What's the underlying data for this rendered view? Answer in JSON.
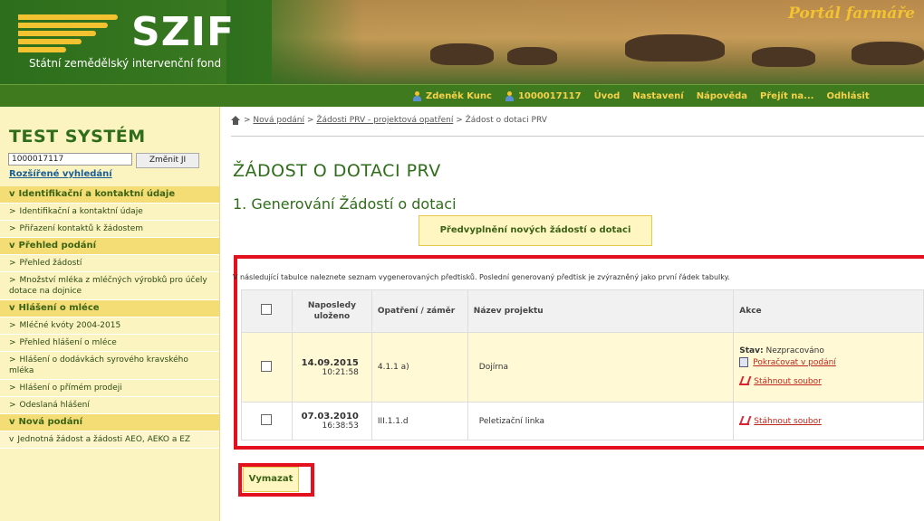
{
  "header": {
    "logo_text": "SZIF",
    "logo_subtitle": "Státní zemědělský intervenční fond",
    "portal_title": "Portál farmáře"
  },
  "topnav": {
    "user_name": "Zdeněk Kunc",
    "user_id": "1000017117",
    "items": [
      "Úvod",
      "Nastavení",
      "Nápověda",
      "Přejít na...",
      "Odhlásit"
    ]
  },
  "sidebar": {
    "system_title": "TEST SYSTÉM",
    "search_value": "1000017117",
    "change_button": "Změnit JI",
    "advanced_search": "Rozšířené vyhledání",
    "items": [
      {
        "label": "Identifikační a kontaktní údaje",
        "type": "section",
        "marker": "v"
      },
      {
        "label": "Identifikační a kontaktní údaje",
        "type": "item",
        "marker": ">"
      },
      {
        "label": "Přiřazení kontaktů k žádostem",
        "type": "item",
        "marker": ">"
      },
      {
        "label": "Přehled podání",
        "type": "section",
        "marker": "v"
      },
      {
        "label": "Přehled žádostí",
        "type": "item",
        "marker": ">"
      },
      {
        "label": "Množství mléka z mléčných výrobků pro účely dotace na dojnice",
        "type": "item",
        "marker": ">"
      },
      {
        "label": "Hlášení o mléce",
        "type": "section",
        "marker": "v"
      },
      {
        "label": "Mléčné kvóty 2004-2015",
        "type": "item",
        "marker": ">"
      },
      {
        "label": "Přehled hlášení o mléce",
        "type": "item",
        "marker": ">"
      },
      {
        "label": "Hlášení o dodávkách syrového kravského mléka",
        "type": "item",
        "marker": ">"
      },
      {
        "label": "Hlášení o přímém prodeji",
        "type": "item",
        "marker": ">"
      },
      {
        "label": "Odeslaná hlášení",
        "type": "item",
        "marker": ">"
      },
      {
        "label": "Nová podání",
        "type": "section",
        "marker": "v"
      },
      {
        "label": "Jednotná žádost a žádosti AEO, AEKO a EZ",
        "type": "sub",
        "marker": "v"
      }
    ]
  },
  "breadcrumb": {
    "sep": ">",
    "links": [
      "Nová podání",
      "Žádosti PRV - projektová opatření"
    ],
    "current": "Žádost o dotaci PRV"
  },
  "main": {
    "page_title": "ŽÁDOST O DOTACI PRV",
    "section_title": "1. Generování Žádostí o dotaci",
    "prefill_button": "Předvyplnění nových žádostí o dotaci",
    "table_note": "V následující tabulce naleznete seznam vygenerovaných předtisků. Poslední generovaný předtisk je zvýrazněný jako první řádek tabulky.",
    "table": {
      "headers": [
        "Naposledy uloženo",
        "Opatření / záměr",
        "Název projektu",
        "Akce"
      ],
      "rows": [
        {
          "date": "14.09.2015",
          "time": "10:21:58",
          "measure": "4.1.1 a)",
          "project": "Dojírna",
          "status_label": "Stav:",
          "status_value": "Nezpracováno",
          "continue_link": "Pokračovat v podání",
          "download_link": "Stáhnout soubor"
        },
        {
          "date": "07.03.2010",
          "time": "16:38:53",
          "measure": "III.1.1.d",
          "project": "Peletizační linka",
          "download_link": "Stáhnout soubor"
        }
      ]
    },
    "delete_button": "Vymazat"
  },
  "colors": {
    "header_green": "#3f7a1e",
    "title_green": "#2f6d1a",
    "sidebar_bg": "#fbf3c0",
    "highlight_red": "#e4101e",
    "link_red": "#c0271c"
  }
}
